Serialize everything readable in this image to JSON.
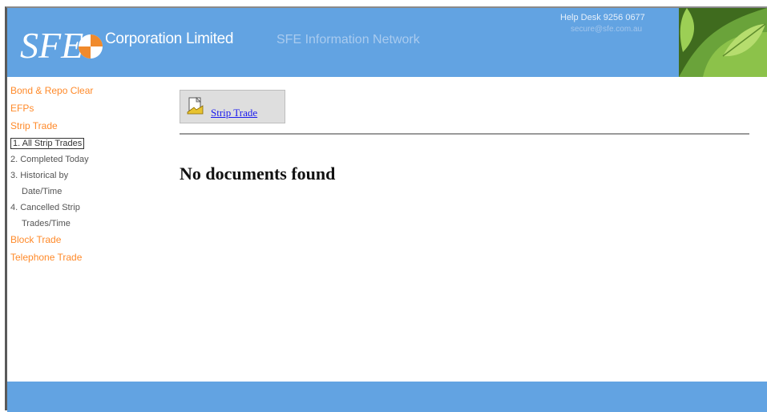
{
  "header": {
    "company_name": "Corporation Limited",
    "network_name": "SFE Information Network",
    "help_desk": "Help Desk 9256 0677",
    "email": "secure@sfe.com.au",
    "brand_color": "#62a3e2"
  },
  "sidebar": {
    "items": [
      {
        "label": "Bond & Repo Clear"
      },
      {
        "label": "EFPs"
      },
      {
        "label": "Strip Trade"
      },
      {
        "label": "Block Trade"
      },
      {
        "label": "Telephone Trade"
      }
    ],
    "strip_sub": [
      {
        "label": "1. All Strip Trades"
      },
      {
        "label": "2. Completed Today"
      },
      {
        "label": "3. Historical by"
      },
      {
        "label": "Date/Time"
      },
      {
        "label": "4. Cancelled Strip"
      },
      {
        "label": "Trades/Time"
      }
    ]
  },
  "main": {
    "tab_label": "Strip Trade",
    "tab_icon": "document-icon",
    "message": "No documents found"
  }
}
